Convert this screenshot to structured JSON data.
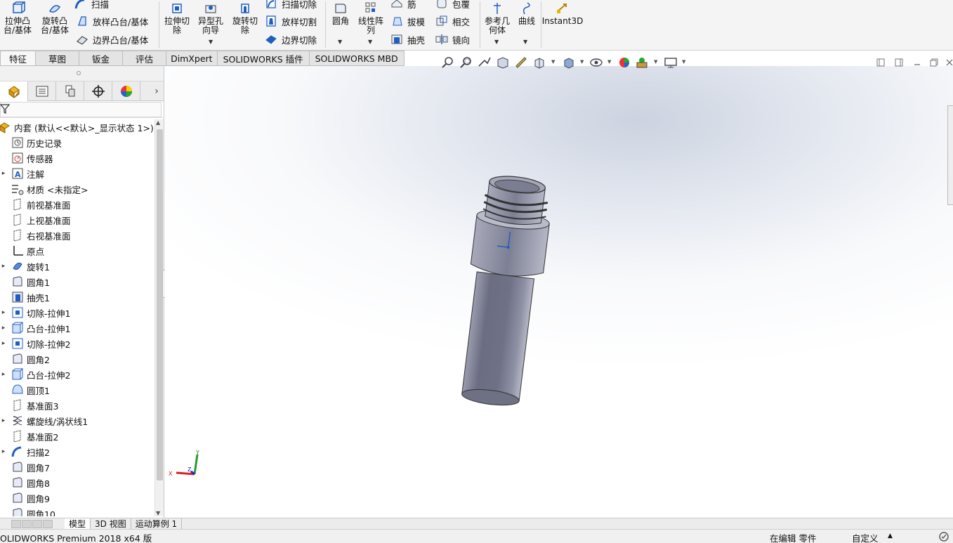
{
  "ribbon": {
    "extrude_boss": "拉伸凸\n台/基体",
    "revolve_boss": "旋转凸\n台/基体",
    "sweep": "扫描",
    "loft_boss": "放样凸台/基体",
    "boundary_boss": "边界凸台/基体",
    "extrude_cut": "拉伸切\n除",
    "hole_wizard": "异型孔\n向导",
    "revolve_cut": "旋转切\n除",
    "swept_cut": "扫描切除",
    "lofted_cut": "放样切割",
    "boundary_cut": "边界切除",
    "fillet": "圆角",
    "linear_pattern": "线性阵\n列",
    "rib": "筋",
    "draft": "拔模",
    "shell": "抽壳",
    "wrap": "包覆",
    "intersect": "相交",
    "mirror": "镜向",
    "reference_geometry": "参考几\n何体",
    "curves": "曲线",
    "instant3d": "Instant3D"
  },
  "command_tabs": [
    "特征",
    "草图",
    "钣金",
    "评估",
    "DimXpert",
    "SOLIDWORKS 插件",
    "SOLIDWORKS MBD"
  ],
  "tree": {
    "root": "内套 (默认<<默认>_显示状态 1>)",
    "items": [
      {
        "label": "历史记录",
        "icon": "history-icon",
        "exp": false
      },
      {
        "label": "传感器",
        "icon": "sensor-icon",
        "exp": false
      },
      {
        "label": "注解",
        "icon": "annotation-icon",
        "exp": true
      },
      {
        "label": "材质 <未指定>",
        "icon": "material-icon",
        "exp": false
      },
      {
        "label": "前视基准面",
        "icon": "plane-icon",
        "exp": false
      },
      {
        "label": "上视基准面",
        "icon": "plane-icon",
        "exp": false
      },
      {
        "label": "右视基准面",
        "icon": "plane-icon",
        "exp": false
      },
      {
        "label": "原点",
        "icon": "origin-icon",
        "exp": false
      },
      {
        "label": "旋转1",
        "icon": "revolve-icon",
        "exp": true
      },
      {
        "label": "圆角1",
        "icon": "fillet-icon",
        "exp": false
      },
      {
        "label": "抽壳1",
        "icon": "shell-icon",
        "exp": false
      },
      {
        "label": "切除-拉伸1",
        "icon": "cut-extrude-icon",
        "exp": true
      },
      {
        "label": "凸台-拉伸1",
        "icon": "boss-extrude-icon",
        "exp": true
      },
      {
        "label": "切除-拉伸2",
        "icon": "cut-extrude-icon",
        "exp": true
      },
      {
        "label": "圆角2",
        "icon": "fillet-icon",
        "exp": false
      },
      {
        "label": "凸台-拉伸2",
        "icon": "boss-extrude-icon",
        "exp": true
      },
      {
        "label": "圆顶1",
        "icon": "dome-icon",
        "exp": false
      },
      {
        "label": "基准面3",
        "icon": "plane-icon",
        "exp": false
      },
      {
        "label": "螺旋线/涡状线1",
        "icon": "helix-icon",
        "exp": true
      },
      {
        "label": "基准面2",
        "icon": "plane-icon",
        "exp": false
      },
      {
        "label": "扫描2",
        "icon": "sweep-icon",
        "exp": true
      },
      {
        "label": "圆角7",
        "icon": "fillet-icon",
        "exp": false
      },
      {
        "label": "圆角8",
        "icon": "fillet-icon",
        "exp": false
      },
      {
        "label": "圆角9",
        "icon": "fillet-icon",
        "exp": false
      },
      {
        "label": "圆角10",
        "icon": "fillet-icon",
        "exp": false
      }
    ]
  },
  "triad": {
    "x": "X",
    "y": "Y",
    "z": "Z"
  },
  "bottom_tabs": [
    "模型",
    "3D 视图",
    "运动算例 1"
  ],
  "status": {
    "app": "OLIDWORKS Premium 2018 x64 版",
    "editing": "在编辑 零件",
    "units": "自定义"
  },
  "colors": {
    "accent_blue": "#1f5fbf",
    "part_body": "#7a7d90"
  }
}
